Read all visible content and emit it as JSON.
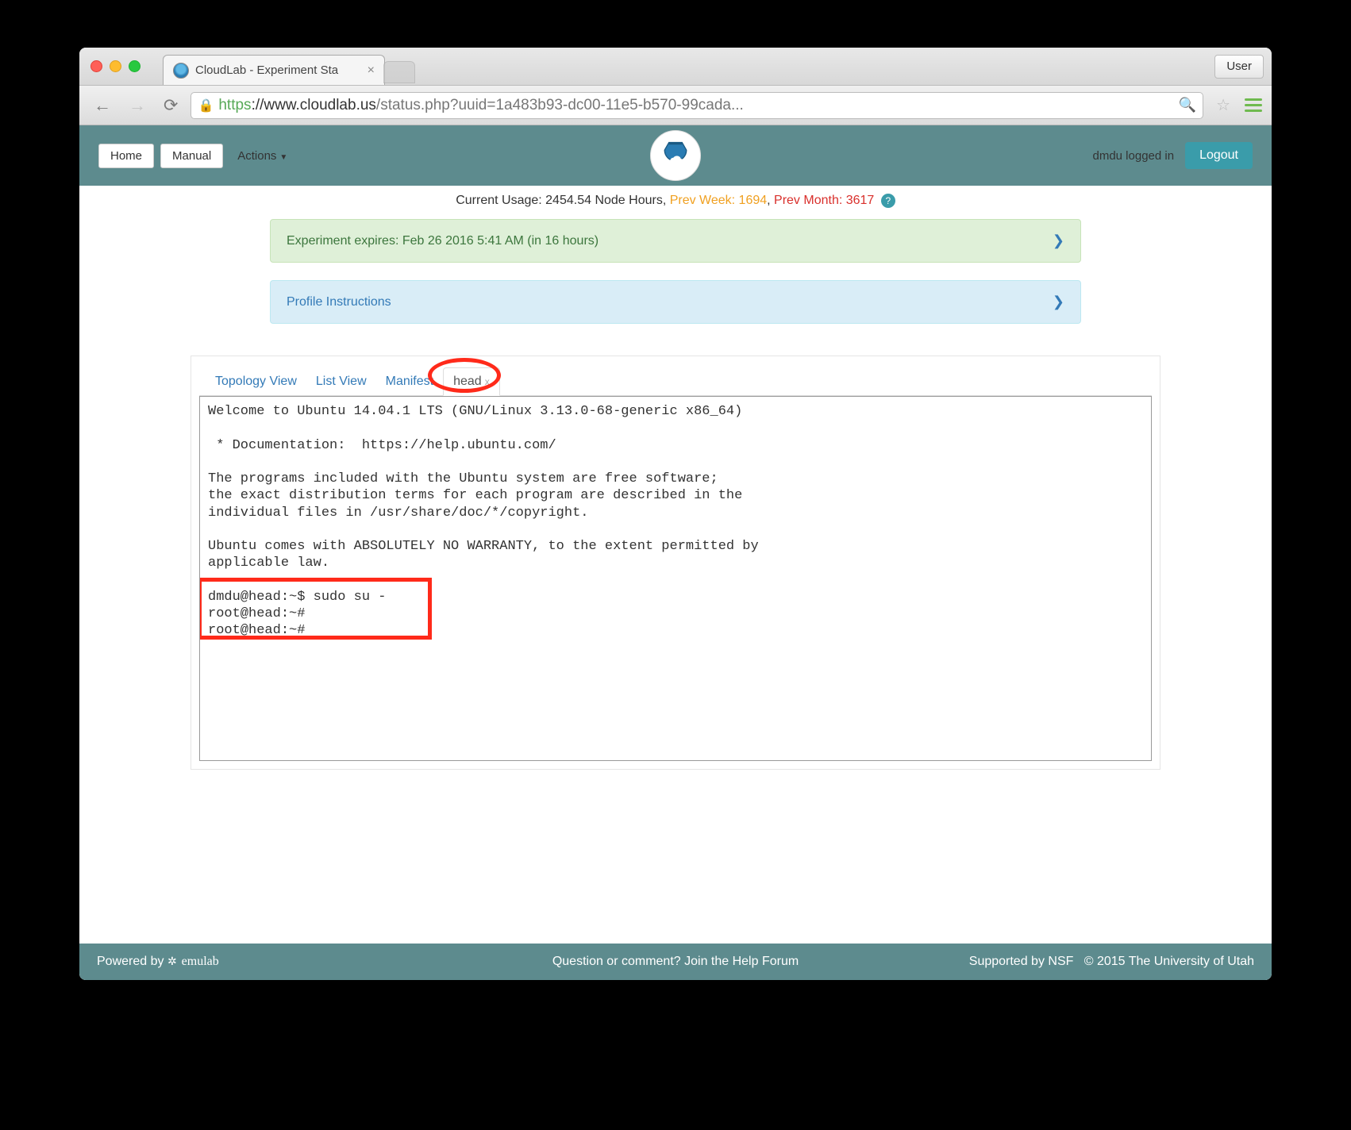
{
  "browser": {
    "tab_title": "CloudLab - Experiment Sta",
    "user_button": "User",
    "url_proto": "https",
    "url_host": "://www.cloudlab.us",
    "url_path": "/status.php?uuid=1a483b93-dc00-11e5-b570-99cada..."
  },
  "navbar": {
    "home": "Home",
    "manual": "Manual",
    "actions": "Actions",
    "logged_in": "dmdu logged in",
    "logout": "Logout"
  },
  "usage": {
    "current_label": "Current Usage: ",
    "current_value": "2454.54 Node Hours",
    "sep1": ", ",
    "prev_week_label": "Prev Week: ",
    "prev_week_value": "1694",
    "sep2": ", ",
    "prev_month_label": "Prev Month: ",
    "prev_month_value": "3617"
  },
  "panels": {
    "expires": "Experiment expires: Feb 26 2016 5:41 AM (in 16 hours)",
    "profile": "Profile Instructions"
  },
  "tabs": {
    "topology": "Topology View",
    "listview": "List View",
    "manifest": "Manifest",
    "head": "head"
  },
  "terminal": {
    "text": "Welcome to Ubuntu 14.04.1 LTS (GNU/Linux 3.13.0-68-generic x86_64)\n\n * Documentation:  https://help.ubuntu.com/\n\nThe programs included with the Ubuntu system are free software;\nthe exact distribution terms for each program are described in the\nindividual files in /usr/share/doc/*/copyright.\n\nUbuntu comes with ABSOLUTELY NO WARRANTY, to the extent permitted by\napplicable law.\n\ndmdu@head:~$ sudo su -\nroot@head:~#\nroot@head:~#"
  },
  "footer": {
    "powered": "Powered by ",
    "emulab": "emulab",
    "help": "Question or comment? Join the Help Forum",
    "nsf": "Supported by NSF",
    "copyright": "© 2015 The University of Utah"
  }
}
